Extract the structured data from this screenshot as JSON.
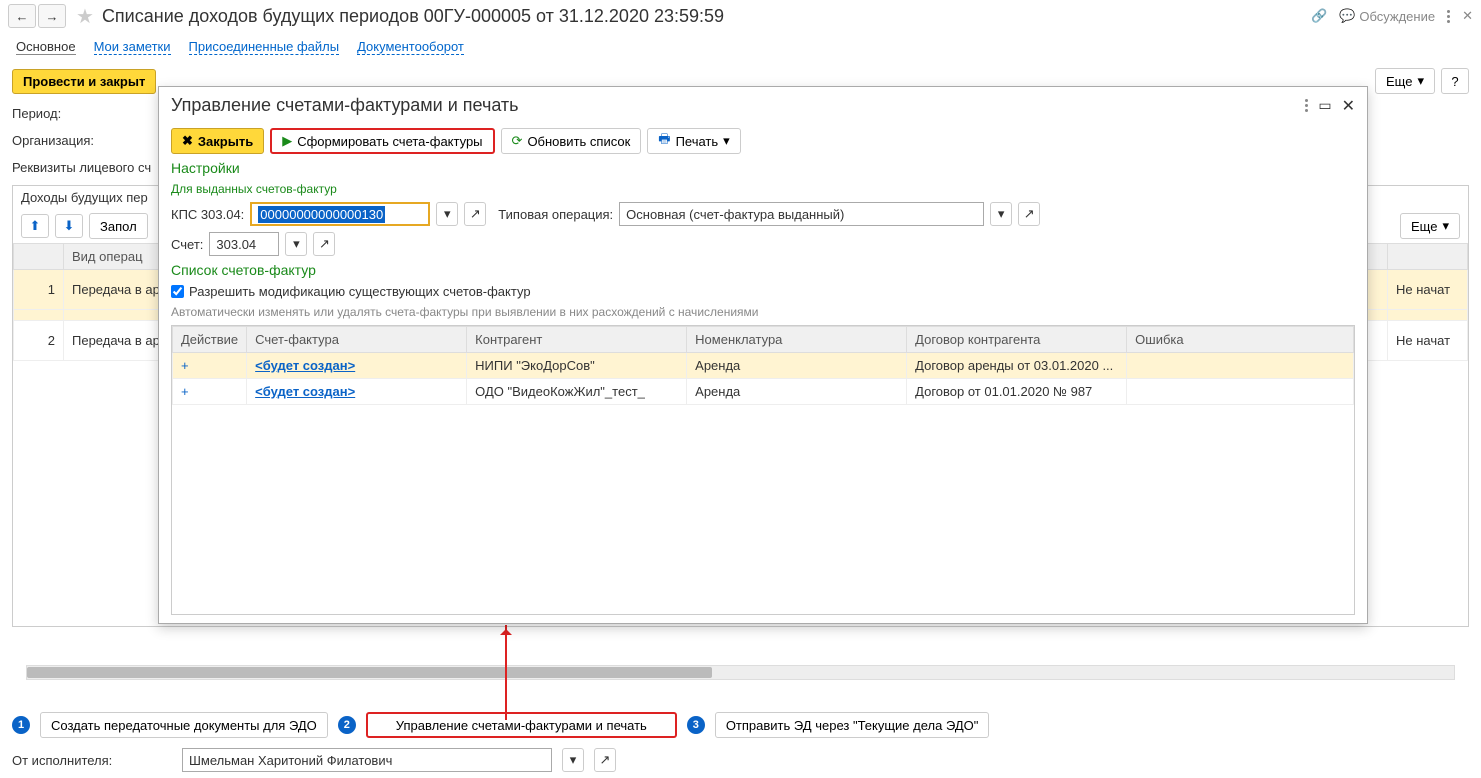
{
  "header": {
    "title": "Списание доходов будущих периодов 00ГУ-000005 от 31.12.2020 23:59:59",
    "discussion": "Обсуждение"
  },
  "tabs": {
    "main": "Основное",
    "notes": "Мои заметки",
    "files": "Присоединенные файлы",
    "docflow": "Документооборот"
  },
  "toolbar": {
    "post_close": "Провести и закрыт",
    "more": "Еще"
  },
  "fields": {
    "period": "Период:",
    "org": "Организация:",
    "account_details": "Реквизиты лицевого сч",
    "executor": "От исполнителя:",
    "executor_val": "Шмельман Харитоний Филатович"
  },
  "panel": {
    "incomes": "Доходы будущих пер",
    "fill": "Запол"
  },
  "bg_table": {
    "cols": {
      "num": "",
      "kind": "Вид операц",
      "status": ""
    },
    "rows": [
      {
        "n": "1",
        "kind": "Передача в аренду",
        "status": "Не начат"
      },
      {
        "n": "2",
        "kind": "Передача в аренду",
        "status": "Не начат"
      }
    ]
  },
  "modal": {
    "title": "Управление счетами-фактурами и печать",
    "close": "Закрыть",
    "form": "Сформировать счета-фактуры",
    "refresh": "Обновить список",
    "print": "Печать",
    "settings": "Настройки",
    "settings_sub": "Для выданных счетов-фактур",
    "kps_label": "КПС 303.04:",
    "kps_val": "00000000000000130",
    "typop_label": "Типовая операция:",
    "typop_val": "Основная (счет-фактура выданный)",
    "acct_label": "Счет:",
    "acct_val": "303.04",
    "list_hdr": "Список счетов-фактур",
    "allow_mod": "Разрешить модификацию существующих счетов-фактур",
    "auto_hint": "Автоматически изменять или удалять счета-фактуры при выявлении в них расхождений с начислениями",
    "cols": {
      "action": "Действие",
      "sf": "Счет-фактура",
      "contr": "Контрагент",
      "nomen": "Номенклатура",
      "dog": "Договор контрагента",
      "err": "Ошибка"
    },
    "rows": [
      {
        "plus": "+",
        "sf": "<будет создан>",
        "contr": "НИПИ \"ЭкоДорСов\"",
        "nomen": "Аренда",
        "dog": "Договор аренды от 03.01.2020 ..."
      },
      {
        "plus": "+",
        "sf": "<будет создан>",
        "contr": "ОДО \"ВидеоКожЖил\"_тест_",
        "nomen": "Аренда",
        "dog": "Договор от 01.01.2020 № 987"
      }
    ]
  },
  "footer_btns": {
    "b1": "Создать передаточные документы для ЭДО",
    "b2": "Управление счетами-фактурами и печать",
    "b3": "Отправить ЭД через \"Текущие дела ЭДО\"",
    "more": "Еще"
  }
}
